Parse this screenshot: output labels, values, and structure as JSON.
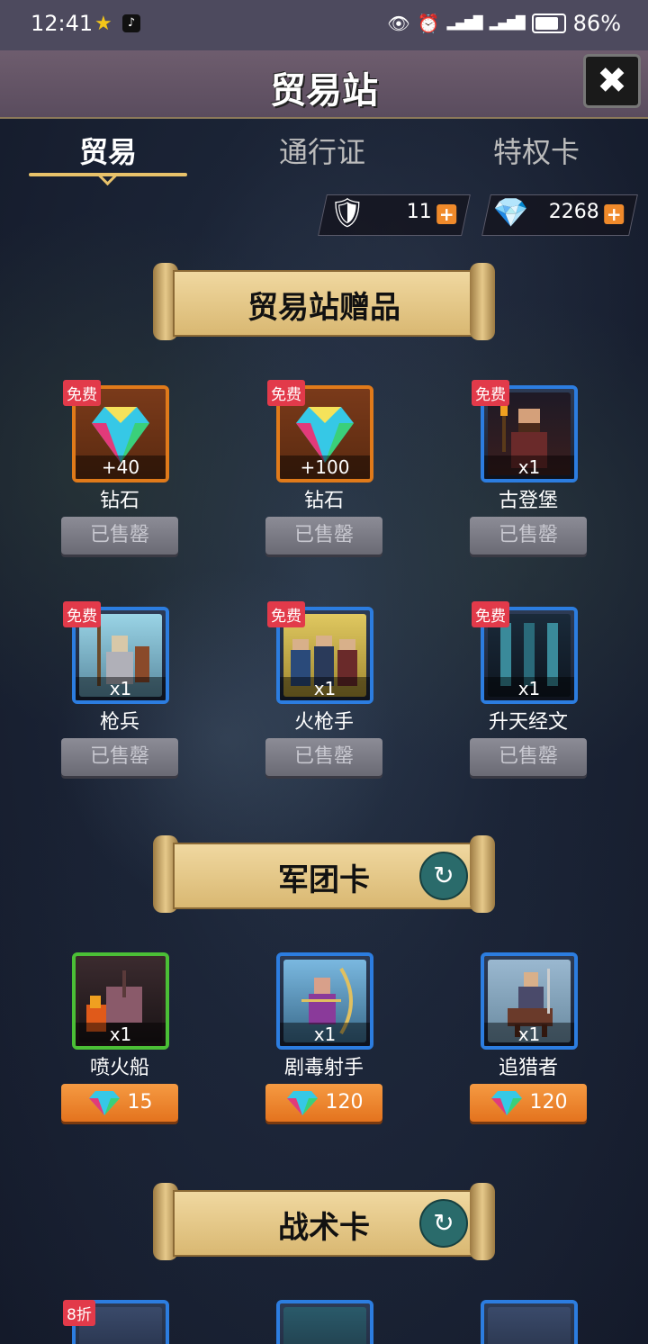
{
  "status_bar": {
    "time": "12:41",
    "battery": "86%",
    "battery_level": 0.86
  },
  "header": {
    "title": "贸易站"
  },
  "tabs": [
    {
      "label": "贸易"
    },
    {
      "label": "通行证"
    },
    {
      "label": "特权卡"
    }
  ],
  "resources": {
    "crest_count": "11",
    "gem_count": "2268"
  },
  "sections": {
    "gifts": "贸易站赠品",
    "legion": "军团卡",
    "tactics": "战术卡"
  },
  "gifts": [
    {
      "name": "钻石",
      "qty": "+40",
      "tag": "免费",
      "button": "已售罄"
    },
    {
      "name": "钻石",
      "qty": "+100",
      "tag": "免费",
      "button": "已售罄"
    },
    {
      "name": "古登堡",
      "qty": "x1",
      "tag": "免费",
      "button": "已售罄"
    },
    {
      "name": "枪兵",
      "qty": "x1",
      "tag": "免费",
      "button": "已售罄"
    },
    {
      "name": "火枪手",
      "qty": "x1",
      "tag": "免费",
      "button": "已售罄"
    },
    {
      "name": "升天经文",
      "qty": "x1",
      "tag": "免费",
      "button": "已售罄"
    }
  ],
  "legion": [
    {
      "name": "喷火船",
      "qty": "x1",
      "price": "15"
    },
    {
      "name": "剧毒射手",
      "qty": "x1",
      "price": "120"
    },
    {
      "name": "追猎者",
      "qty": "x1",
      "price": "120"
    }
  ],
  "tactics": [
    {
      "tag": "8折"
    }
  ],
  "colors": {
    "accent": "#e8c26a",
    "free_tag": "#e23a4a",
    "buy_button": "#f08a2b",
    "sold_button": "#7a7a84"
  }
}
